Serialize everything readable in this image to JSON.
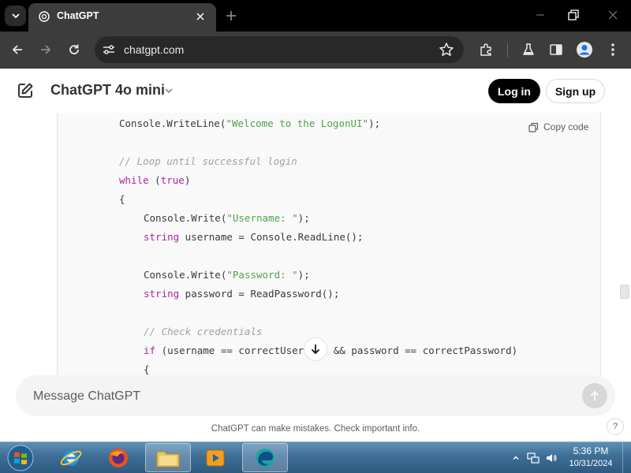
{
  "browser": {
    "tab_title": "ChatGPT",
    "url": "chatgpt.com"
  },
  "header": {
    "model_title": "ChatGPT 4o mini",
    "login_label": "Log in",
    "signup_label": "Sign up"
  },
  "code_block": {
    "copy_label": "Copy code",
    "lines": [
      {
        "indent": 2,
        "tokens": [
          [
            "plain",
            "Console.WriteLine("
          ],
          [
            "str",
            "\"Welcome to the LogonUI\""
          ],
          [
            "plain",
            ");"
          ]
        ]
      },
      {
        "indent": 0,
        "tokens": []
      },
      {
        "indent": 2,
        "tokens": [
          [
            "cmt",
            "// Loop until successful login"
          ]
        ]
      },
      {
        "indent": 2,
        "tokens": [
          [
            "kw",
            "while"
          ],
          [
            "plain",
            " ("
          ],
          [
            "kw",
            "true"
          ],
          [
            "plain",
            ")"
          ]
        ]
      },
      {
        "indent": 2,
        "tokens": [
          [
            "plain",
            "{"
          ]
        ]
      },
      {
        "indent": 3,
        "tokens": [
          [
            "plain",
            "Console.Write("
          ],
          [
            "str",
            "\"Username: \""
          ],
          [
            "plain",
            ");"
          ]
        ]
      },
      {
        "indent": 3,
        "tokens": [
          [
            "kw",
            "string"
          ],
          [
            "plain",
            " username = Console.ReadLine();"
          ]
        ]
      },
      {
        "indent": 0,
        "tokens": []
      },
      {
        "indent": 3,
        "tokens": [
          [
            "plain",
            "Console.Write("
          ],
          [
            "str",
            "\"Password: \""
          ],
          [
            "plain",
            ");"
          ]
        ]
      },
      {
        "indent": 3,
        "tokens": [
          [
            "kw",
            "string"
          ],
          [
            "plain",
            " password = ReadPassword();"
          ]
        ]
      },
      {
        "indent": 0,
        "tokens": []
      },
      {
        "indent": 3,
        "tokens": [
          [
            "cmt",
            "// Check credentials"
          ]
        ]
      },
      {
        "indent": 3,
        "tokens": [
          [
            "kw",
            "if"
          ],
          [
            "plain",
            " (username == correctUsername && password == correctPassword)"
          ]
        ]
      },
      {
        "indent": 3,
        "tokens": [
          [
            "plain",
            "{"
          ]
        ]
      }
    ]
  },
  "composer": {
    "placeholder": "Message ChatGPT",
    "disclaimer": "ChatGPT can make mistakes. Check important info.",
    "help_label": "?"
  },
  "taskbar": {
    "time": "5:36 PM",
    "date": "10/31/2024"
  },
  "colors": {
    "keyword": "#a626a4",
    "string": "#50a14f",
    "comment": "#a0a1a7",
    "plain": "#383a42"
  }
}
